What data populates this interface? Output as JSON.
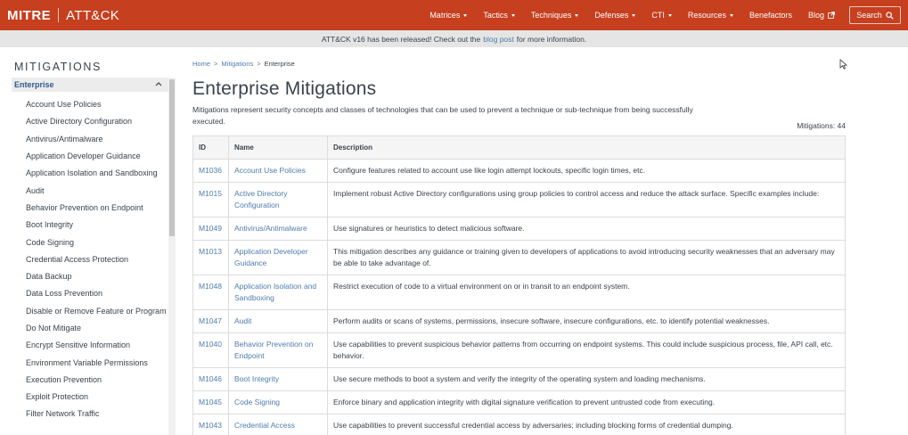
{
  "header": {
    "brand_left": "MITRE",
    "brand_right": "ATT&CK",
    "nav": [
      {
        "label": "Matrices",
        "dropdown": true
      },
      {
        "label": "Tactics",
        "dropdown": true
      },
      {
        "label": "Techniques",
        "dropdown": true
      },
      {
        "label": "Defenses",
        "dropdown": true
      },
      {
        "label": "CTI",
        "dropdown": true
      },
      {
        "label": "Resources",
        "dropdown": true
      },
      {
        "label": "Benefactors",
        "dropdown": false
      },
      {
        "label": "Blog",
        "dropdown": false,
        "external": true
      }
    ],
    "search_label": "Search"
  },
  "banner": {
    "before": "ATT&CK v16 has been released! Check out the",
    "link": "blog post",
    "after": "for more information."
  },
  "sidebar": {
    "title": "MITIGATIONS",
    "section": "Enterprise",
    "items": [
      "Account Use Policies",
      "Active Directory Configuration",
      "Antivirus/Antimalware",
      "Application Developer Guidance",
      "Application Isolation and Sandboxing",
      "Audit",
      "Behavior Prevention on Endpoint",
      "Boot Integrity",
      "Code Signing",
      "Credential Access Protection",
      "Data Backup",
      "Data Loss Prevention",
      "Disable or Remove Feature or Program",
      "Do Not Mitigate",
      "Encrypt Sensitive Information",
      "Environment Variable Permissions",
      "Execution Prevention",
      "Exploit Protection",
      "Filter Network Traffic"
    ]
  },
  "main": {
    "breadcrumb": [
      "Home",
      "Mitigations",
      "Enterprise"
    ],
    "title": "Enterprise Mitigations",
    "intro": "Mitigations represent security concepts and classes of technologies that can be used to prevent a technique or sub-technique from being successfully executed.",
    "count": "Mitigations: 44",
    "table": {
      "headers": [
        "ID",
        "Name",
        "Description"
      ],
      "rows": [
        {
          "id": "M1036",
          "name": "Account Use Policies",
          "desc": "Configure features related to account use like login attempt lockouts, specific login times, etc."
        },
        {
          "id": "M1015",
          "name": "Active Directory Configuration",
          "desc": "Implement robust Active Directory configurations using group policies to control access and reduce the attack surface. Specific examples include:"
        },
        {
          "id": "M1049",
          "name": "Antivirus/Antimalware",
          "desc": "Use signatures or heuristics to detect malicious software."
        },
        {
          "id": "M1013",
          "name": "Application Developer Guidance",
          "desc": "This mitigation describes any guidance or training given to developers of applications to avoid introducing security weaknesses that an adversary may be able to take advantage of."
        },
        {
          "id": "M1048",
          "name": "Application Isolation and Sandboxing",
          "desc": "Restrict execution of code to a virtual environment on or in transit to an endpoint system."
        },
        {
          "id": "M1047",
          "name": "Audit",
          "desc": "Perform audits or scans of systems, permissions, insecure software, insecure configurations, etc. to identify potential weaknesses."
        },
        {
          "id": "M1040",
          "name": "Behavior Prevention on Endpoint",
          "desc": "Use capabilities to prevent suspicious behavior patterns from occurring on endpoint systems. This could include suspicious process, file, API call, etc. behavior."
        },
        {
          "id": "M1046",
          "name": "Boot Integrity",
          "desc": "Use secure methods to boot a system and verify the integrity of the operating system and loading mechanisms."
        },
        {
          "id": "M1045",
          "name": "Code Signing",
          "desc": "Enforce binary and application integrity with digital signature verification to prevent untrusted code from executing."
        },
        {
          "id": "M1043",
          "name": "Credential Access",
          "desc": "Use capabilities to prevent successful credential access by adversaries; including blocking forms of credential dumping."
        }
      ]
    }
  },
  "colors": {
    "nav_bg": "#c63f1f",
    "link": "#4f7cac",
    "text": "#39434c",
    "banner_bg": "#e5e5e5"
  }
}
